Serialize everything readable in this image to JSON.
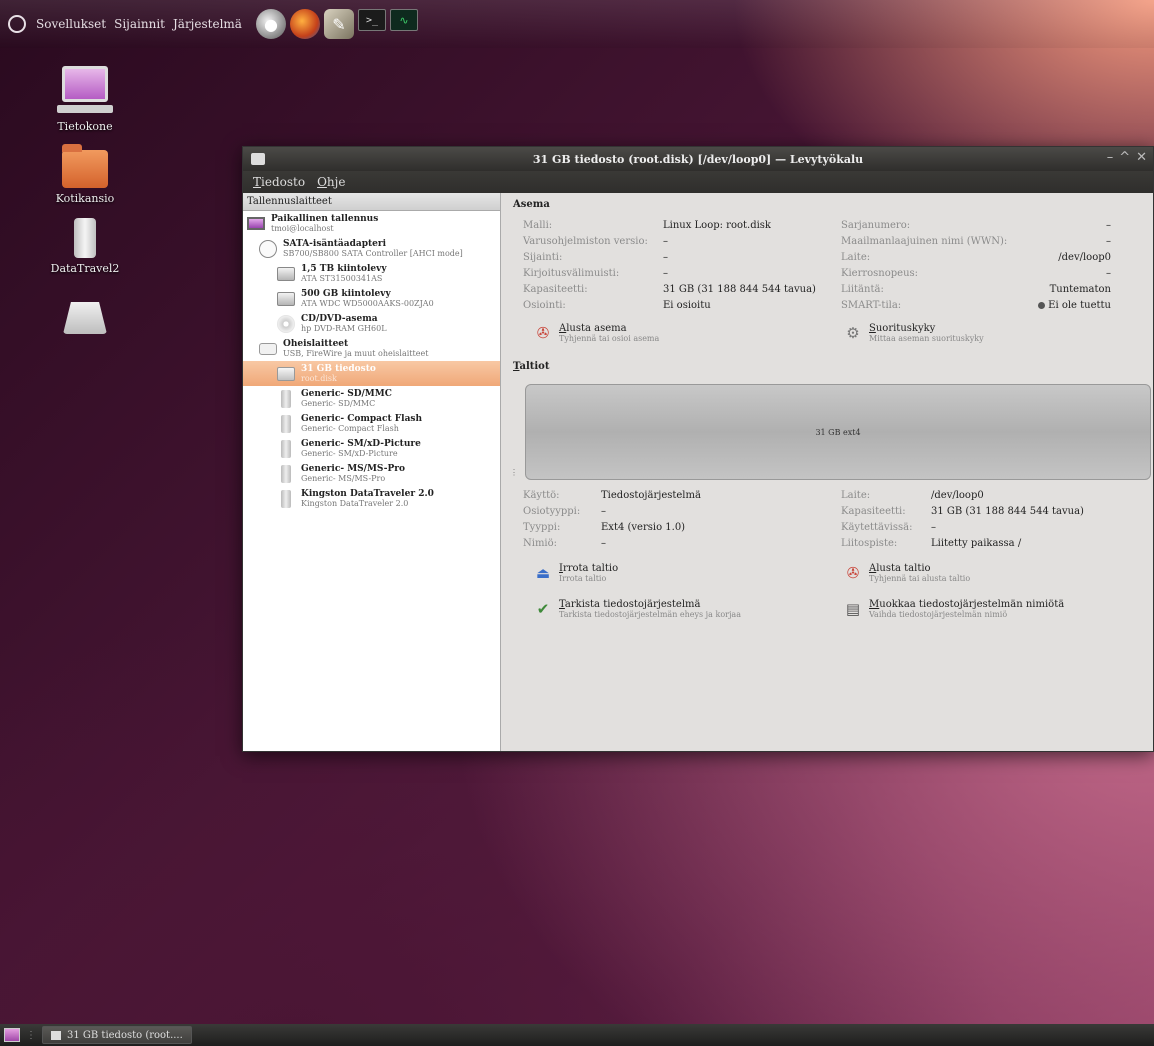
{
  "top_panel": {
    "menu": [
      "Sovellukset",
      "Sijainnit",
      "Järjestelmä"
    ]
  },
  "desktop_icons": [
    {
      "name": "computer",
      "label": "Tietokone"
    },
    {
      "name": "home-folder",
      "label": "Kotikansio"
    },
    {
      "name": "usb-drive",
      "label": "DataTravel2"
    },
    {
      "name": "drive",
      "label": ""
    }
  ],
  "window": {
    "title": "31 GB tiedosto (root.disk) [/dev/loop0] — Levytyökalu",
    "menu": [
      "Tiedosto",
      "Ohje"
    ],
    "sidebar_header": "Tallennuslaitteet",
    "tree": [
      {
        "level": 1,
        "icon": "screen",
        "name": "Paikallinen tallennus",
        "sub": "tmoi@localhost",
        "selected": false
      },
      {
        "level": 2,
        "icon": "sata",
        "name": "SATA-isäntäadapteri",
        "sub": "SB700/SB800 SATA Controller [AHCI mode]",
        "selected": false
      },
      {
        "level": 3,
        "icon": "hdd",
        "name": "1,5 TB kiintolevy",
        "sub": "ATA ST31500341AS",
        "selected": false
      },
      {
        "level": 3,
        "icon": "hdd",
        "name": "500 GB kiintolevy",
        "sub": "ATA WDC WD5000AAKS-00ZJA0",
        "selected": false
      },
      {
        "level": 3,
        "icon": "cd",
        "name": "CD/DVD-asema",
        "sub": "hp DVD-RAM GH60L",
        "selected": false
      },
      {
        "level": 2,
        "icon": "usbhub",
        "name": "Oheislaitteet",
        "sub": "USB, FireWire ja muut oheislaitteet",
        "selected": false
      },
      {
        "level": 3,
        "icon": "disk",
        "name": "31 GB tiedosto",
        "sub": "root.disk",
        "selected": true
      },
      {
        "level": 3,
        "icon": "card",
        "name": "Generic- SD/MMC",
        "sub": "Generic- SD/MMC",
        "selected": false
      },
      {
        "level": 3,
        "icon": "card",
        "name": "Generic- Compact Flash",
        "sub": "Generic- Compact Flash",
        "selected": false
      },
      {
        "level": 3,
        "icon": "card",
        "name": "Generic- SM/xD-Picture",
        "sub": "Generic- SM/xD-Picture",
        "selected": false
      },
      {
        "level": 3,
        "icon": "card",
        "name": "Generic- MS/MS-Pro",
        "sub": "Generic- MS/MS-Pro",
        "selected": false
      },
      {
        "level": 3,
        "icon": "card",
        "name": "Kingston DataTraveler 2.0",
        "sub": "Kingston DataTraveler 2.0",
        "selected": false
      }
    ],
    "asema": {
      "title": "Asema",
      "rows": [
        [
          "Malli:",
          "Linux Loop: root.disk",
          "Sarjanumero:",
          "–"
        ],
        [
          "Varusohjelmiston versio:",
          "–",
          "Maailmanlaajuinen nimi (WWN):",
          "–"
        ],
        [
          "Sijainti:",
          "–",
          "Laite:",
          "/dev/loop0"
        ],
        [
          "Kirjoitusvälimuisti:",
          "–",
          "Kierrosnopeus:",
          "–"
        ],
        [
          "Kapasiteetti:",
          "31 GB (31 188 844 544 tavua)",
          "Liitäntä:",
          "Tuntematon"
        ],
        [
          "Osiointi:",
          "Ei osioitu",
          "SMART-tila:",
          "Ei ole tuettu"
        ]
      ],
      "actions": [
        {
          "title": "Alusta asema",
          "sub": "Tyhjennä tai osioi asema"
        },
        {
          "title": "Suorituskyky",
          "sub": "Mittaa aseman suorituskyky"
        }
      ]
    },
    "taltiot": {
      "title": "Taltiot",
      "volume_label": "31 GB ext4",
      "rows": [
        [
          "Käyttö:",
          "Tiedostojärjestelmä",
          "Laite:",
          "/dev/loop0"
        ],
        [
          "Osiotyyppi:",
          "–",
          "Kapasiteetti:",
          "31 GB (31 188 844 544 tavua)"
        ],
        [
          "Tyyppi:",
          "Ext4 (versio 1.0)",
          "Käytettävissä:",
          "–"
        ],
        [
          "Nimiö:",
          "–",
          "Liitospiste:",
          "Liitetty paikassa /"
        ]
      ],
      "actions": [
        {
          "title": "Irrota taltio",
          "sub": "Irrota taltio"
        },
        {
          "title": "Alusta taltio",
          "sub": "Tyhjennä tai alusta taltio"
        },
        {
          "title": "Tarkista tiedostojärjestelmä",
          "sub": "Tarkista tiedostojärjestelmän eheys ja korjaa"
        },
        {
          "title": "Muokkaa tiedostojärjestelmän nimiötä",
          "sub": "Vaihda tiedostojärjestelmän nimiö"
        }
      ]
    }
  },
  "taskbar": {
    "task_label": "31 GB tiedosto (root...."
  }
}
